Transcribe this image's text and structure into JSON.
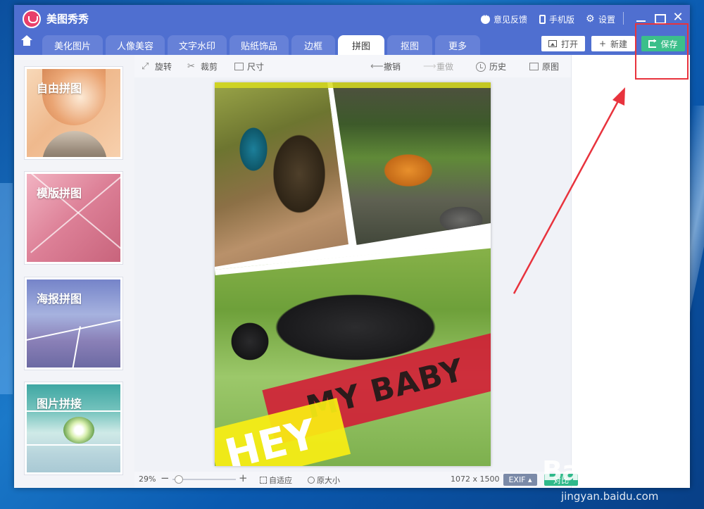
{
  "app": {
    "title": "美图秀秀"
  },
  "titlebar": {
    "links": [
      {
        "label": "意见反馈",
        "icon": "feedback-icon"
      },
      {
        "label": "手机版",
        "icon": "phone-icon"
      },
      {
        "label": "设置",
        "icon": "gear-icon"
      }
    ],
    "close_glyph": "✕"
  },
  "tabs": [
    {
      "label": "美化图片"
    },
    {
      "label": "人像美容"
    },
    {
      "label": "文字水印"
    },
    {
      "label": "贴纸饰品"
    },
    {
      "label": "边框"
    },
    {
      "label": "拼图",
      "active": true
    },
    {
      "label": "抠图"
    },
    {
      "label": "更多"
    }
  ],
  "actions": {
    "open_label": "打开",
    "new_label": "新建",
    "save_label": "保存",
    "new_glyph": "+"
  },
  "sidebar": {
    "cards": [
      {
        "label": "自由拼图"
      },
      {
        "label": "模版拼图"
      },
      {
        "label": "海报拼图"
      },
      {
        "label": "图片拼接"
      }
    ]
  },
  "toolbar": {
    "rotate_label": "旋转",
    "crop_label": "裁剪",
    "size_label": "尺寸",
    "undo_label": "撤销",
    "redo_label": "重做",
    "history_label": "历史",
    "original_label": "原图",
    "rotate_glyph": "⤢",
    "crop_glyph": "✂",
    "undo_glyph": "⟵",
    "redo_glyph": "⟶"
  },
  "canvas": {
    "sticker_red_text": "MY BABY",
    "sticker_yellow_text": "HEY"
  },
  "statusbar": {
    "zoom": "29%",
    "zoom_minus": "−",
    "zoom_plus": "+",
    "fit_label": "自适应",
    "original_size_label": "原大小",
    "dimensions": "1072 x 1500",
    "exif_label": "EXIF ▴",
    "compare_label": "对比"
  },
  "watermark": {
    "main": "Baidu经验",
    "sub": "jingyan.baidu.com"
  },
  "colors": {
    "titlebar": "#4f6fd0",
    "save_button": "#3bbf8a",
    "annotation": "#e8333d"
  }
}
